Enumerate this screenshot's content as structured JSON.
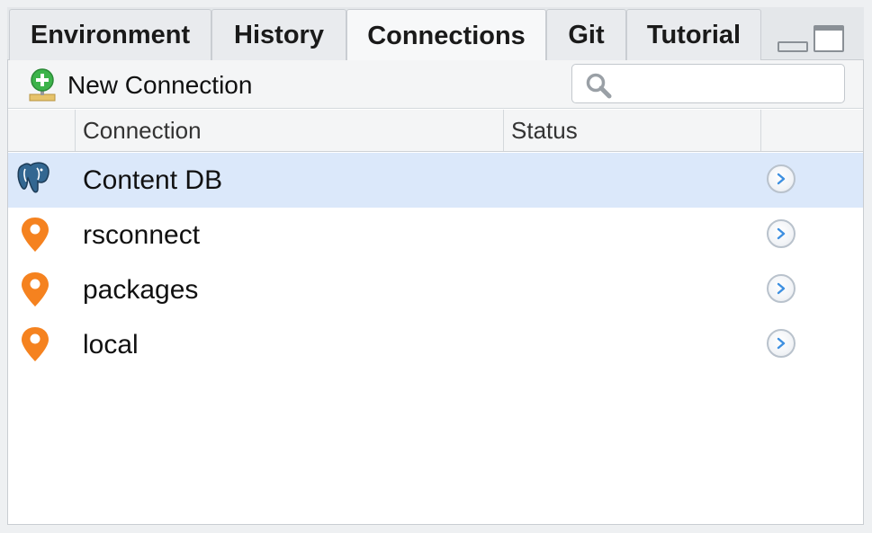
{
  "tabs": [
    {
      "label": "Environment",
      "active": false
    },
    {
      "label": "History",
      "active": false
    },
    {
      "label": "Connections",
      "active": true
    },
    {
      "label": "Git",
      "active": false
    },
    {
      "label": "Tutorial",
      "active": false
    }
  ],
  "toolbar": {
    "new_connection_label": "New Connection",
    "new_connection_icon": "plus-icon",
    "search": {
      "value": "",
      "placeholder": "",
      "icon": "search-icon"
    }
  },
  "table": {
    "columns": [
      "",
      "Connection",
      "Status",
      ""
    ],
    "rows": [
      {
        "name": "Content DB",
        "status": "",
        "icon": "postgres-elephant-icon",
        "selected": true
      },
      {
        "name": "rsconnect",
        "status": "",
        "icon": "map-pin-icon",
        "selected": false
      },
      {
        "name": "packages",
        "status": "",
        "icon": "map-pin-icon",
        "selected": false
      },
      {
        "name": "local",
        "status": "",
        "icon": "map-pin-icon",
        "selected": false
      }
    ]
  },
  "colors": {
    "selected_row": "#dbe8fa",
    "pin_orange": "#f5821f",
    "plus_green": "#3cb34a",
    "arrow_blue": "#3d8fe0",
    "postgres_blue": "#336791"
  }
}
